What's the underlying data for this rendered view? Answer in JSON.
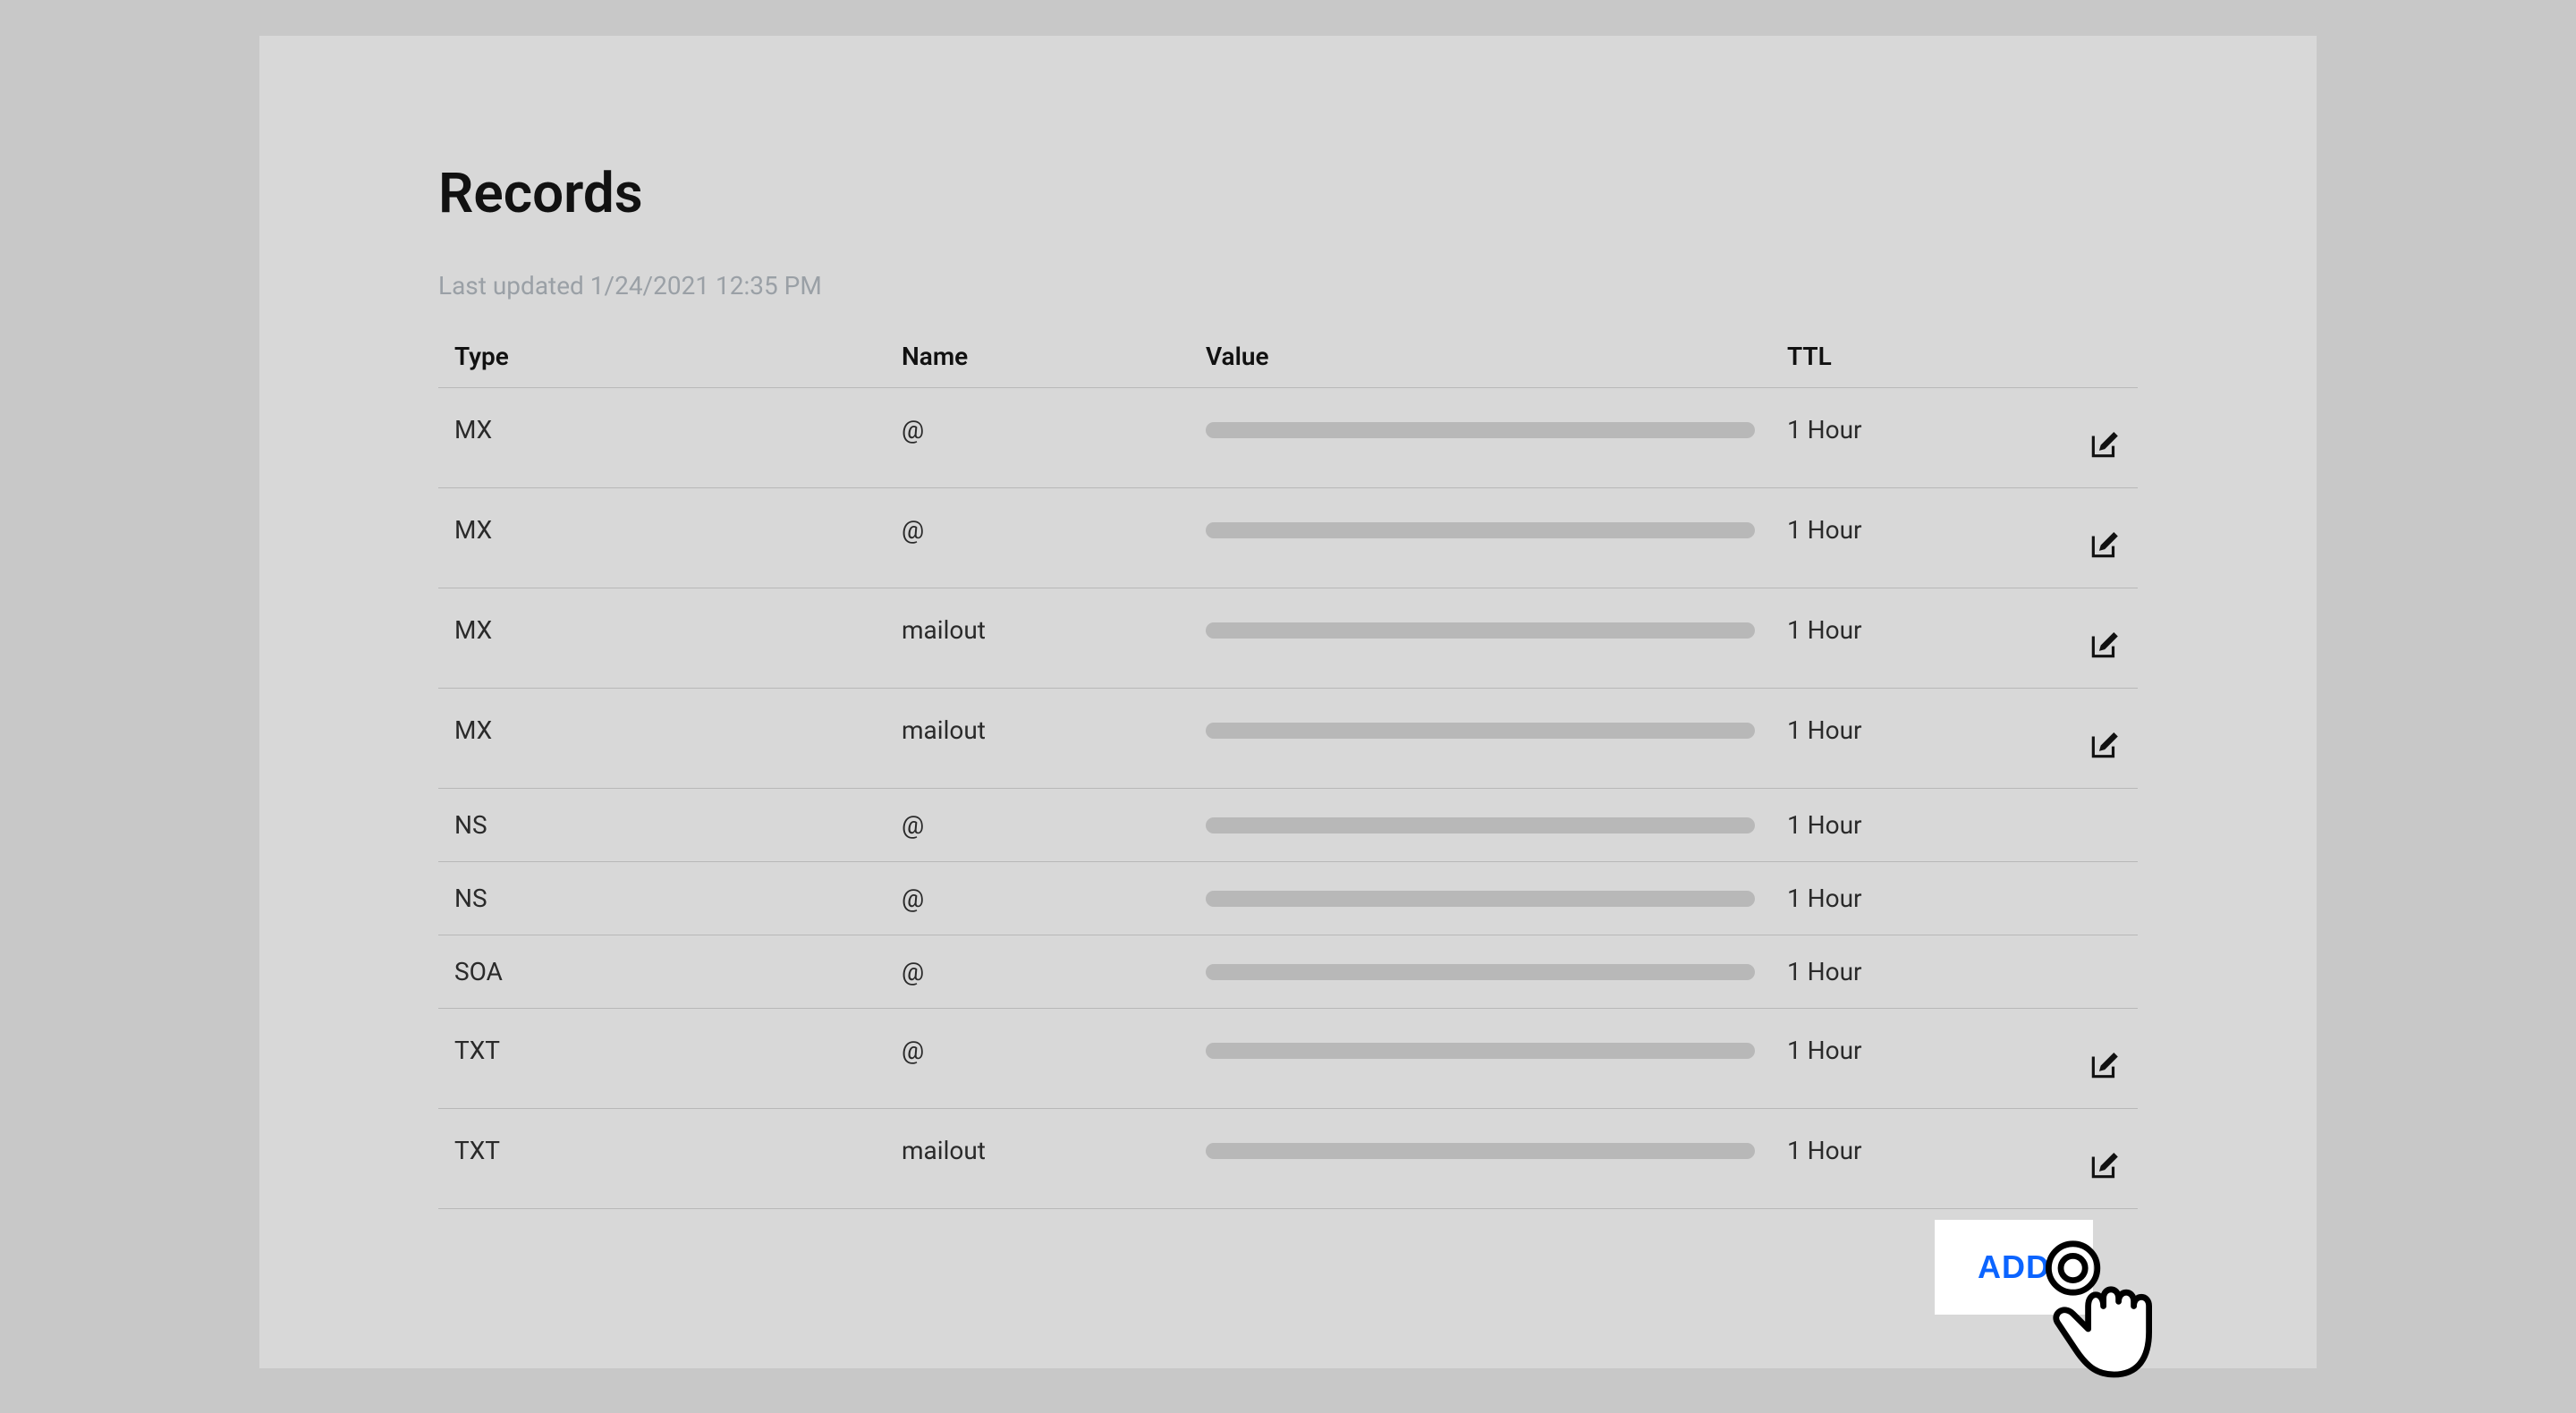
{
  "page_title": "Records",
  "last_updated": "Last updated 1/24/2021 12:35 PM",
  "columns": {
    "type": "Type",
    "name": "Name",
    "value": "Value",
    "ttl": "TTL"
  },
  "records": [
    {
      "type": "MX",
      "name": "@",
      "ttl": "1 Hour",
      "editable": true,
      "tall": true
    },
    {
      "type": "MX",
      "name": "@",
      "ttl": "1 Hour",
      "editable": true,
      "tall": true
    },
    {
      "type": "MX",
      "name": "mailout",
      "ttl": "1 Hour",
      "editable": true,
      "tall": true
    },
    {
      "type": "MX",
      "name": "mailout",
      "ttl": "1 Hour",
      "editable": true,
      "tall": true
    },
    {
      "type": "NS",
      "name": "@",
      "ttl": "1 Hour",
      "editable": false,
      "tall": false
    },
    {
      "type": "NS",
      "name": "@",
      "ttl": "1 Hour",
      "editable": false,
      "tall": false
    },
    {
      "type": "SOA",
      "name": "@",
      "ttl": "1 Hour",
      "editable": false,
      "tall": false
    },
    {
      "type": "TXT",
      "name": "@",
      "ttl": "1 Hour",
      "editable": true,
      "tall": true
    },
    {
      "type": "TXT",
      "name": "mailout",
      "ttl": "1 Hour",
      "editable": true,
      "tall": true
    }
  ],
  "add_button_label": "ADD"
}
